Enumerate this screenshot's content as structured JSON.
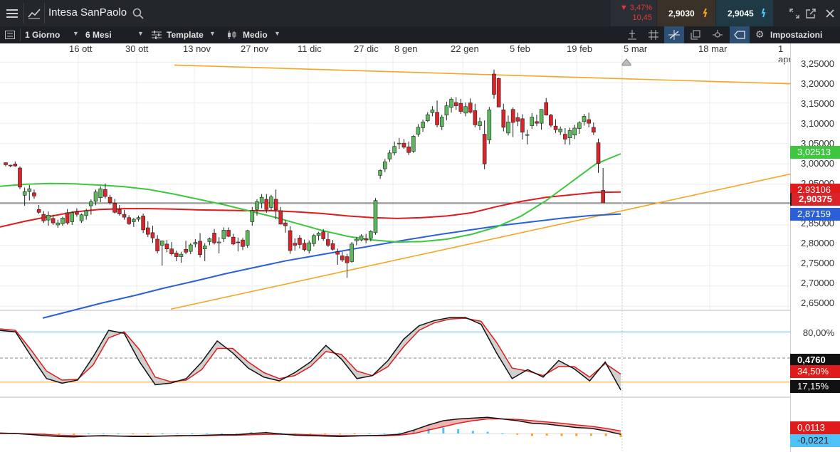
{
  "header": {
    "menu_icon": "hamburger-icon",
    "chart_icon": "line-chart-icon",
    "instrument": "Intesa SanPaolo",
    "search_icon": "search-icon",
    "change_pct": "▼ 3,47%",
    "change_abs": "10,45",
    "bid": "2,9030",
    "ask": "2,9045",
    "window_icons": [
      "resize-icon",
      "popout-icon",
      "close-icon"
    ]
  },
  "toolbar": {
    "interval": "1 Giorno",
    "range": "6 Mesi",
    "template": "Template",
    "indicator": "Medio",
    "settings": "Impostazioni"
  },
  "colors": {
    "ma_fast": "#3ec63e",
    "ma_mid": "#e01b1b",
    "ma_slow": "#2a5fd8",
    "trendline": "#f5a623",
    "up": "#5cb85c",
    "down": "#d9242a"
  },
  "chart_data": [
    {
      "type": "candlestick",
      "title": "Intesa SanPaolo",
      "x_ticks": [
        "16 ott",
        "30 ott",
        "13 nov",
        "27 nov",
        "11 dic",
        "27 dic",
        "8 gen",
        "22 gen",
        "5 feb",
        "19 feb",
        "5 mar",
        "18 mar",
        "1 apr"
      ],
      "y_ticks": [
        "3,25000",
        "3,20000",
        "3,15000",
        "3,10000",
        "3,05000",
        "3,00000",
        "2,95000",
        "2,90000",
        "2,85000",
        "2,80000",
        "2,75000",
        "2,70000",
        "2,65000"
      ],
      "ylim": [
        2.64,
        3.27
      ],
      "candles": [
        [
          3.003,
          3.004,
          2.994,
          2.998
        ],
        [
          2.997,
          2.998,
          2.992,
          2.995
        ],
        [
          3.0,
          3.006,
          2.993,
          2.995
        ],
        [
          2.99,
          2.994,
          2.938,
          2.943
        ],
        [
          2.923,
          2.942,
          2.897,
          2.932
        ],
        [
          2.932,
          2.948,
          2.91,
          2.939
        ],
        [
          2.929,
          2.937,
          2.914,
          2.921
        ],
        [
          2.888,
          2.899,
          2.877,
          2.881
        ],
        [
          2.876,
          2.884,
          2.855,
          2.86
        ],
        [
          2.862,
          2.883,
          2.848,
          2.874
        ],
        [
          2.866,
          2.875,
          2.85,
          2.855
        ],
        [
          2.85,
          2.863,
          2.843,
          2.855
        ],
        [
          2.853,
          2.87,
          2.848,
          2.867
        ],
        [
          2.88,
          2.889,
          2.851,
          2.855
        ],
        [
          2.858,
          2.883,
          2.85,
          2.88
        ],
        [
          2.882,
          2.891,
          2.87,
          2.876
        ],
        [
          2.86,
          2.878,
          2.855,
          2.875
        ],
        [
          2.873,
          2.89,
          2.863,
          2.885
        ],
        [
          2.897,
          2.913,
          2.875,
          2.907
        ],
        [
          2.908,
          2.937,
          2.898,
          2.931
        ],
        [
          2.917,
          2.945,
          2.906,
          2.939
        ],
        [
          2.937,
          2.952,
          2.915,
          2.92
        ],
        [
          2.918,
          2.924,
          2.9,
          2.905
        ],
        [
          2.903,
          2.914,
          2.878,
          2.881
        ],
        [
          2.888,
          2.899,
          2.873,
          2.877
        ],
        [
          2.876,
          2.887,
          2.863,
          2.869
        ],
        [
          2.868,
          2.874,
          2.85,
          2.853
        ],
        [
          2.858,
          2.867,
          2.845,
          2.864
        ],
        [
          2.864,
          2.873,
          2.858,
          2.868
        ],
        [
          2.872,
          2.878,
          2.83,
          2.838
        ],
        [
          2.843,
          2.859,
          2.82,
          2.827
        ],
        [
          2.831,
          2.848,
          2.806,
          2.818
        ],
        [
          2.815,
          2.825,
          2.78,
          2.786
        ],
        [
          2.8,
          2.811,
          2.75,
          2.811
        ],
        [
          2.803,
          2.813,
          2.783,
          2.791
        ],
        [
          2.791,
          2.808,
          2.775,
          2.779
        ],
        [
          2.781,
          2.787,
          2.761,
          2.772
        ],
        [
          2.772,
          2.784,
          2.757,
          2.778
        ],
        [
          2.79,
          2.811,
          2.778,
          2.783
        ],
        [
          2.785,
          2.805,
          2.778,
          2.801
        ],
        [
          2.803,
          2.815,
          2.795,
          2.807
        ],
        [
          2.81,
          2.83,
          2.77,
          2.777
        ],
        [
          2.791,
          2.805,
          2.761,
          2.798
        ],
        [
          2.809,
          2.819,
          2.8,
          2.816
        ],
        [
          2.83,
          2.84,
          2.802,
          2.806
        ],
        [
          2.806,
          2.82,
          2.78,
          2.808
        ],
        [
          2.816,
          2.844,
          2.808,
          2.837
        ],
        [
          2.837,
          2.844,
          2.82,
          2.822
        ],
        [
          2.82,
          2.828,
          2.8,
          2.803
        ],
        [
          2.808,
          2.819,
          2.785,
          2.807
        ],
        [
          2.813,
          2.818,
          2.788,
          2.797
        ],
        [
          2.8,
          2.838,
          2.794,
          2.836
        ],
        [
          2.858,
          2.894,
          2.848,
          2.885
        ],
        [
          2.888,
          2.913,
          2.873,
          2.907
        ],
        [
          2.904,
          2.926,
          2.891,
          2.918
        ],
        [
          2.913,
          2.926,
          2.88,
          2.888
        ],
        [
          2.893,
          2.924,
          2.886,
          2.919
        ],
        [
          2.913,
          2.937,
          2.864,
          2.887
        ],
        [
          2.885,
          2.894,
          2.851,
          2.852
        ],
        [
          2.855,
          2.862,
          2.831,
          2.848
        ],
        [
          2.836,
          2.847,
          2.779,
          2.787
        ],
        [
          2.805,
          2.817,
          2.787,
          2.8
        ],
        [
          2.818,
          2.825,
          2.792,
          2.802
        ],
        [
          2.805,
          2.814,
          2.785,
          2.789
        ],
        [
          2.787,
          2.812,
          2.78,
          2.806
        ],
        [
          2.804,
          2.828,
          2.797,
          2.824
        ],
        [
          2.824,
          2.833,
          2.812,
          2.83
        ],
        [
          2.833,
          2.84,
          2.811,
          2.816
        ],
        [
          2.814,
          2.831,
          2.796,
          2.8
        ],
        [
          2.804,
          2.813,
          2.787,
          2.79
        ],
        [
          2.784,
          2.792,
          2.752,
          2.778
        ],
        [
          2.774,
          2.784,
          2.759,
          2.764
        ],
        [
          2.772,
          2.779,
          2.72,
          2.757
        ],
        [
          2.76,
          2.808,
          2.757,
          2.803
        ],
        [
          2.811,
          2.82,
          2.8,
          2.815
        ],
        [
          2.813,
          2.827,
          2.81,
          2.823
        ],
        [
          2.816,
          2.828,
          2.805,
          2.813
        ],
        [
          2.817,
          2.837,
          2.81,
          2.834
        ],
        [
          2.831,
          2.916,
          2.826,
          2.91
        ],
        [
          2.972,
          2.987,
          2.963,
          2.984
        ],
        [
          2.988,
          3.012,
          2.98,
          3.005
        ],
        [
          3.012,
          3.034,
          3.005,
          3.027
        ],
        [
          3.027,
          3.055,
          3.021,
          3.043
        ],
        [
          3.051,
          3.064,
          3.037,
          3.051
        ],
        [
          3.051,
          3.061,
          3.037,
          3.041
        ],
        [
          3.042,
          3.055,
          3.022,
          3.028
        ],
        [
          3.031,
          3.071,
          3.027,
          3.068
        ],
        [
          3.073,
          3.098,
          3.067,
          3.09
        ],
        [
          3.089,
          3.109,
          3.079,
          3.103
        ],
        [
          3.106,
          3.127,
          3.103,
          3.121
        ],
        [
          3.126,
          3.142,
          3.117,
          3.133
        ],
        [
          3.127,
          3.156,
          3.09,
          3.096
        ],
        [
          3.092,
          3.121,
          3.083,
          3.115
        ],
        [
          3.12,
          3.153,
          3.107,
          3.143
        ],
        [
          3.139,
          3.164,
          3.126,
          3.159
        ],
        [
          3.151,
          3.164,
          3.133,
          3.143
        ],
        [
          3.149,
          3.16,
          3.123,
          3.129
        ],
        [
          3.125,
          3.151,
          3.117,
          3.141
        ],
        [
          3.15,
          3.161,
          3.124,
          3.127
        ],
        [
          3.131,
          3.148,
          3.09,
          3.096
        ],
        [
          3.094,
          3.114,
          3.083,
          3.104
        ],
        [
          3.073,
          3.107,
          2.987,
          3.0
        ],
        [
          3.059,
          3.14,
          3.049,
          3.133
        ],
        [
          3.221,
          3.232,
          3.16,
          3.171
        ],
        [
          3.21,
          3.212,
          3.14,
          3.14
        ],
        [
          3.133,
          3.148,
          3.08,
          3.09
        ],
        [
          3.076,
          3.119,
          3.07,
          3.103
        ],
        [
          3.134,
          3.139,
          3.066,
          3.102
        ],
        [
          3.114,
          3.126,
          3.093,
          3.105
        ],
        [
          3.111,
          3.122,
          3.06,
          3.078
        ],
        [
          3.071,
          3.084,
          3.048,
          3.072
        ],
        [
          3.094,
          3.125,
          3.086,
          3.115
        ],
        [
          3.104,
          3.121,
          3.093,
          3.1
        ],
        [
          3.1,
          3.132,
          3.084,
          3.134
        ],
        [
          3.151,
          3.162,
          3.119,
          3.12
        ],
        [
          3.12,
          3.123,
          3.09,
          3.095
        ],
        [
          3.093,
          3.11,
          3.076,
          3.084
        ],
        [
          3.079,
          3.092,
          3.071,
          3.086
        ],
        [
          3.073,
          3.088,
          3.048,
          3.061
        ],
        [
          3.064,
          3.089,
          3.047,
          3.082
        ],
        [
          3.071,
          3.096,
          3.061,
          3.088
        ],
        [
          3.087,
          3.105,
          3.074,
          3.101
        ],
        [
          3.104,
          3.123,
          3.094,
          3.117
        ],
        [
          3.109,
          3.126,
          3.09,
          3.1
        ],
        [
          3.09,
          3.102,
          3.071,
          3.078
        ],
        [
          3.052,
          3.062,
          2.978,
          3.001
        ],
        [
          2.935,
          2.99,
          2.926,
          2.904
        ]
      ],
      "ma_fast": [
        2.945,
        2.95,
        2.952,
        2.951,
        2.948,
        2.944,
        2.937,
        2.926,
        2.913,
        2.9,
        2.885,
        2.87,
        2.853,
        2.836,
        2.822,
        2.813,
        2.808,
        2.809,
        2.815,
        2.827,
        2.845,
        2.872,
        2.91,
        2.955,
        3.0,
        3.025
      ],
      "ma_mid": [
        2.845,
        2.859,
        2.871,
        2.882,
        2.888,
        2.89,
        2.89,
        2.889,
        2.887,
        2.886,
        2.885,
        2.885,
        2.882,
        2.878,
        2.872,
        2.868,
        2.866,
        2.868,
        2.872,
        2.88,
        2.895,
        2.908,
        2.918,
        2.924,
        2.93,
        2.931
      ],
      "ma_slow": [
        2.621,
        2.64,
        2.659,
        2.676,
        2.695,
        2.712,
        2.73,
        2.746,
        2.762,
        2.775,
        2.788,
        2.801,
        2.814,
        2.826,
        2.837,
        2.848,
        2.857,
        2.866,
        2.873,
        2.877
      ],
      "trendline_top": [
        [
          3.243,
          3.197
        ]
      ],
      "trendline_bottom": [
        [
          2.643,
          2.975
        ]
      ],
      "last_price": "2,90375",
      "labels": {
        "ma_fast": "3,02513",
        "ma_mid": "2,93106",
        "ma_slow": "2,87159"
      },
      "marker_label": "5 mar"
    },
    {
      "type": "line",
      "title": "",
      "levels": {
        "upper": "80,00%",
        "lower": "17,15%"
      },
      "k_value": "0,4760",
      "d_value": "34,50%",
      "k": [
        0.82,
        0.8,
        0.48,
        0.18,
        0.12,
        0.16,
        0.47,
        0.82,
        0.78,
        0.4,
        0.1,
        0.12,
        0.18,
        0.4,
        0.68,
        0.52,
        0.32,
        0.2,
        0.15,
        0.26,
        0.4,
        0.62,
        0.44,
        0.18,
        0.22,
        0.42,
        0.7,
        0.88,
        0.95,
        0.99,
        0.99,
        0.9,
        0.52,
        0.18,
        0.3,
        0.2,
        0.42,
        0.31,
        0.15,
        0.4,
        0.03
      ],
      "d": [
        0.84,
        0.82,
        0.56,
        0.28,
        0.16,
        0.17,
        0.36,
        0.72,
        0.8,
        0.56,
        0.2,
        0.14,
        0.16,
        0.3,
        0.58,
        0.58,
        0.4,
        0.26,
        0.18,
        0.22,
        0.34,
        0.54,
        0.5,
        0.28,
        0.22,
        0.34,
        0.6,
        0.82,
        0.92,
        0.97,
        0.98,
        0.94,
        0.66,
        0.32,
        0.28,
        0.22,
        0.34,
        0.34,
        0.2,
        0.38,
        0.24
      ]
    },
    {
      "type": "line",
      "title": "",
      "macd_value": "0,0113",
      "signal_value": "-0,0221",
      "macd": [
        0.01,
        0.0,
        -0.02,
        -0.05,
        -0.07,
        -0.08,
        -0.06,
        -0.05,
        -0.06,
        -0.07,
        -0.07,
        -0.06,
        -0.05,
        -0.05,
        -0.04,
        -0.03,
        -0.03,
        0.0,
        0.02,
        -0.01,
        -0.04,
        -0.05,
        -0.06,
        -0.07,
        -0.06,
        -0.05,
        -0.04,
        -0.02,
        0.08,
        0.2,
        0.3,
        0.34,
        0.36,
        0.38,
        0.34,
        0.3,
        0.24,
        0.22,
        0.18,
        0.14,
        0.12,
        0.06,
        -0.02
      ],
      "signal": [
        0.0,
        0.0,
        -0.01,
        -0.02,
        -0.04,
        -0.05,
        -0.06,
        -0.06,
        -0.06,
        -0.06,
        -0.06,
        -0.06,
        -0.06,
        -0.05,
        -0.05,
        -0.04,
        -0.04,
        -0.03,
        -0.02,
        -0.02,
        -0.02,
        -0.03,
        -0.04,
        -0.05,
        -0.05,
        -0.05,
        -0.05,
        -0.04,
        0.0,
        0.08,
        0.16,
        0.24,
        0.3,
        0.34,
        0.34,
        0.33,
        0.3,
        0.27,
        0.24,
        0.2,
        0.17,
        0.12,
        0.06
      ],
      "histogram": [
        0.01,
        0.01,
        -0.01,
        -0.03,
        -0.03,
        -0.03,
        0.0,
        0.01,
        0.0,
        -0.01,
        -0.01,
        0.0,
        0.01,
        0.0,
        0.01,
        0.01,
        0.01,
        0.03,
        0.04,
        0.01,
        -0.02,
        -0.02,
        -0.02,
        -0.02,
        -0.01,
        0.0,
        0.01,
        0.02,
        0.08,
        0.12,
        0.14,
        0.1,
        0.06,
        0.04,
        0.0,
        -0.03,
        -0.06,
        -0.05,
        -0.06,
        -0.06,
        -0.05,
        -0.06,
        -0.08
      ]
    }
  ]
}
